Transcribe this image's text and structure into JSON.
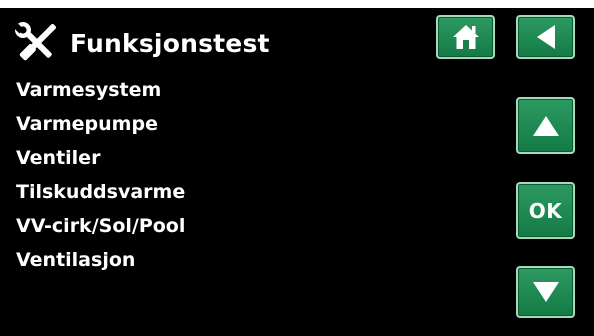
{
  "header": {
    "title": "Funksjonstest",
    "icon": "tools-icon"
  },
  "menu": {
    "items": [
      {
        "label": "Varmesystem"
      },
      {
        "label": "Varmepumpe"
      },
      {
        "label": "Ventiler"
      },
      {
        "label": "Tilskuddsvarme"
      },
      {
        "label": "VV-cirk/Sol/Pool"
      },
      {
        "label": "Ventilasjon"
      }
    ]
  },
  "buttons": {
    "home_icon": "home-icon",
    "back_icon": "arrow-left-icon",
    "up_icon": "arrow-up-icon",
    "ok_label": "OK",
    "down_icon": "arrow-down-icon"
  },
  "colors": {
    "background": "#000000",
    "text": "#ffffff",
    "button_green": "#1f8a52",
    "button_border": "#a8d8bb"
  }
}
